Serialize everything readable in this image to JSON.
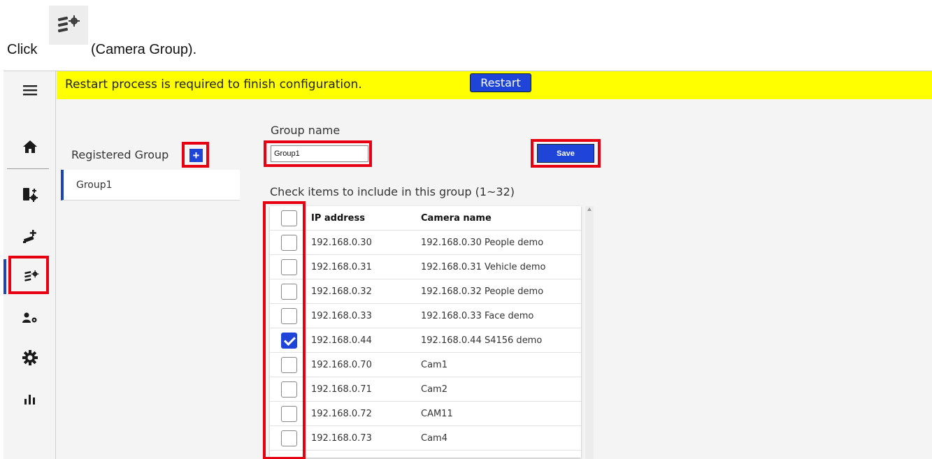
{
  "instruction": {
    "click_word": "Click",
    "icon": "camera-group-icon",
    "rest": "(Camera Group)."
  },
  "banner": {
    "text": "Restart process is required to finish configuration.",
    "restart_label": "Restart",
    "color": "#ffff00"
  },
  "sidebar": {
    "items": [
      {
        "icon": "menu-icon"
      },
      {
        "icon": "home-icon"
      },
      {
        "icon": "camera-settings-icon"
      },
      {
        "icon": "add-camera-icon"
      },
      {
        "icon": "camera-group-icon",
        "active": true
      },
      {
        "icon": "user-settings-icon"
      },
      {
        "icon": "gear-icon"
      },
      {
        "icon": "statistics-icon"
      }
    ]
  },
  "registered": {
    "label": "Registered Group",
    "add_label": "+",
    "groups": [
      "Group1"
    ]
  },
  "form": {
    "group_name_label": "Group name",
    "group_name_value": "Group1",
    "save_label": "Save",
    "check_label": "Check items to include in this group (1~32)"
  },
  "table": {
    "headers": {
      "ip": "IP address",
      "name": "Camera name"
    },
    "rows": [
      {
        "ip": "192.168.0.30",
        "name": "192.168.0.30 People demo",
        "checked": false
      },
      {
        "ip": "192.168.0.31",
        "name": "192.168.0.31 Vehicle demo",
        "checked": false
      },
      {
        "ip": "192.168.0.32",
        "name": "192.168.0.32 People demo",
        "checked": false
      },
      {
        "ip": "192.168.0.33",
        "name": "192.168.0.33 Face demo",
        "checked": false
      },
      {
        "ip": "192.168.0.44",
        "name": "192.168.0.44 S4156 demo",
        "checked": true
      },
      {
        "ip": "192.168.0.70",
        "name": "Cam1",
        "checked": false
      },
      {
        "ip": "192.168.0.71",
        "name": "Cam2",
        "checked": false
      },
      {
        "ip": "192.168.0.72",
        "name": "CAM11",
        "checked": false
      },
      {
        "ip": "192.168.0.73",
        "name": "Cam4",
        "checked": false
      }
    ]
  },
  "colors": {
    "accent": "#1e45d8",
    "highlight": "#e60012",
    "banner": "#ffff00"
  }
}
